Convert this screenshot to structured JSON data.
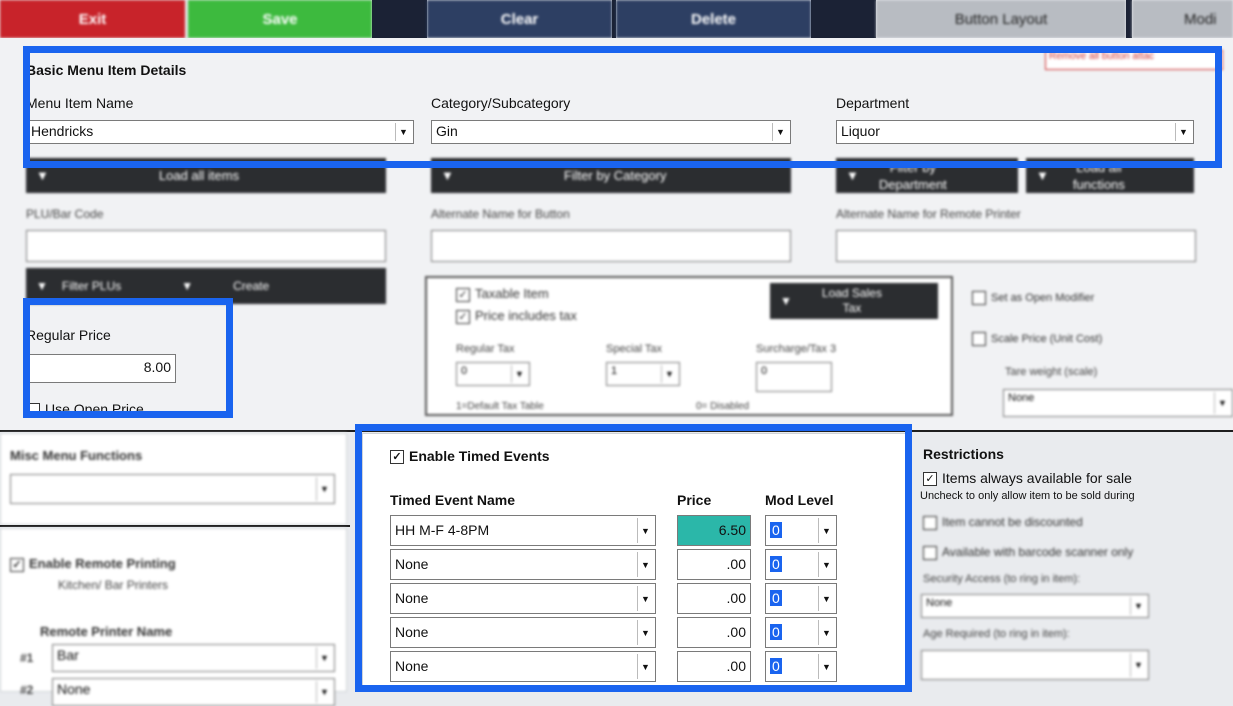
{
  "toolbar": {
    "exit": "Exit",
    "save": "Save",
    "clear": "Clear",
    "delete": "Delete",
    "button_layout": "Button Layout",
    "modifiers": "Modi",
    "remove_all_button": "Remove all button attac"
  },
  "basic": {
    "heading": "Basic Menu Item Details",
    "name_label": "Menu Item Name",
    "name_value": "Hendricks",
    "category_label": "Category/Subcategory",
    "category_value": "Gin",
    "department_label": "Department",
    "department_value": "Liquor",
    "load_all_items": "Load all items",
    "filter_by_category": "Filter by Category",
    "filter_by_department_1": "Filter by",
    "filter_by_department_2": "Department",
    "load_all_functions_1": "Load all",
    "load_all_functions_2": "functions"
  },
  "codes": {
    "plu_label": "PLU/Bar Code",
    "alt_button_label": "Alternate Name for Button",
    "alt_printer_label": "Alternate Name for Remote Printer",
    "filter_plus": "Filter PLUs",
    "create": "Create"
  },
  "tax": {
    "taxable": "Taxable Item",
    "price_includes_tax": "Price includes tax",
    "load_sales_tax_1": "Load Sales",
    "load_sales_tax_2": "Tax",
    "regular_tax_label": "Regular Tax",
    "regular_tax_value": "0",
    "special_tax_label": "Special Tax",
    "special_tax_value": "1",
    "surcharge_label": "Surcharge/Tax 3",
    "surcharge_value": "0",
    "footnote_left": "1=Default Tax Table",
    "footnote_right": "0= Disabled"
  },
  "options": {
    "open_modifier": "Set as Open Modifier",
    "scale_price": "Scale Price (Unit Cost)",
    "tare_label": "Tare weight (scale)",
    "tare_value": "None"
  },
  "price": {
    "label": "Regular Price",
    "value": "8.00",
    "open_price": "Use Open Price"
  },
  "misc": {
    "label": "Misc Menu Functions",
    "value": ""
  },
  "remote": {
    "enable": "Enable Remote Printing",
    "sub": "Kitchen/ Bar Printers",
    "name_label": "Remote Printer Name",
    "rows": [
      {
        "num": "#1",
        "value": "Bar"
      },
      {
        "num": "#2",
        "value": "None"
      }
    ]
  },
  "timed": {
    "enable": "Enable Timed Events",
    "col_name": "Timed Event Name",
    "col_price": "Price",
    "col_mod": "Mod Level",
    "rows": [
      {
        "name": "HH M-F 4-8PM",
        "price": "6.50",
        "mod": "0"
      },
      {
        "name": "None",
        "price": ".00",
        "mod": "0"
      },
      {
        "name": "None",
        "price": ".00",
        "mod": "0"
      },
      {
        "name": "None",
        "price": ".00",
        "mod": "0"
      },
      {
        "name": "None",
        "price": ".00",
        "mod": "0"
      }
    ]
  },
  "restrictions": {
    "heading": "Restrictions",
    "always_available": "Items always available for sale",
    "uncheck_note": "Uncheck to only allow item to be sold during",
    "cannot_discount": "Item cannot be discounted",
    "barcode_only": "Available with barcode scanner only",
    "security_label": "Security Access (to ring in item):",
    "security_value": "None",
    "age_label": "Age Required (to ring in item):",
    "age_value": ""
  }
}
